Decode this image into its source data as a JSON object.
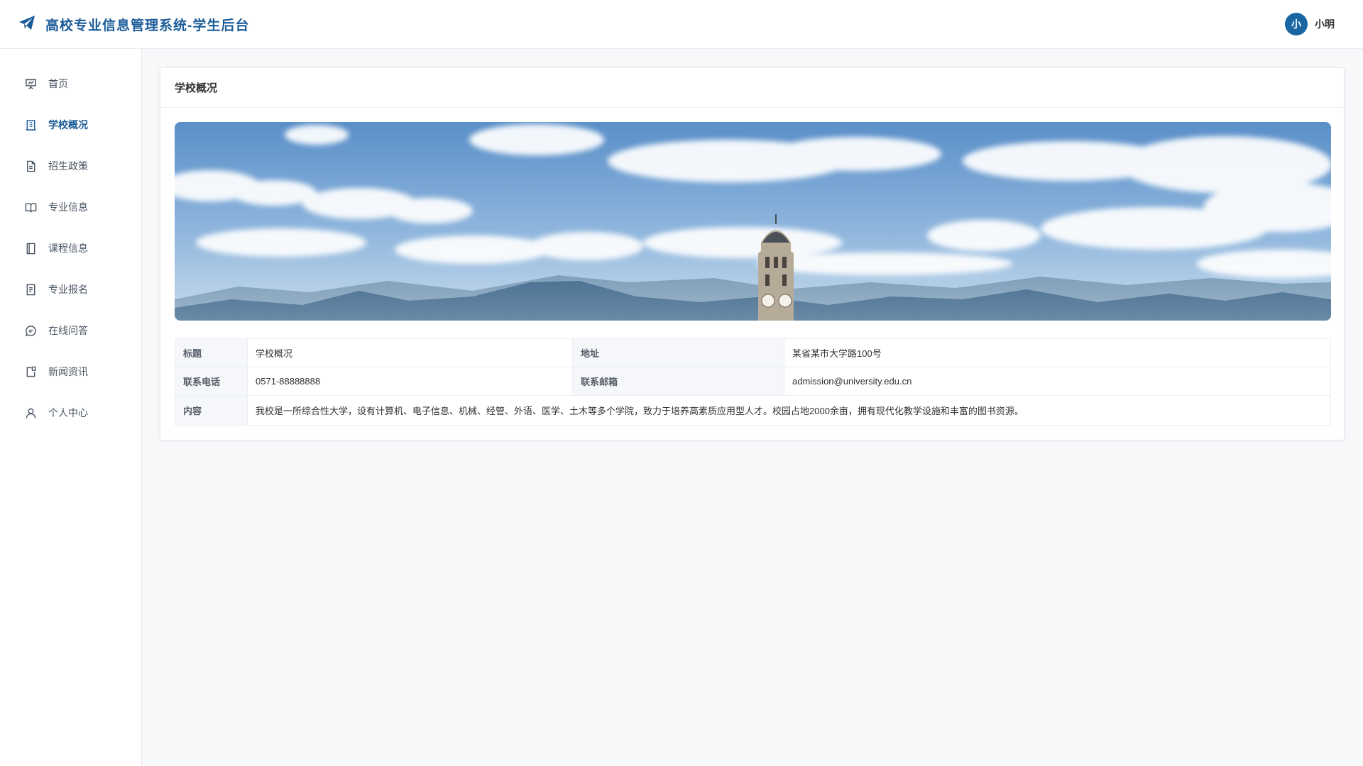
{
  "header": {
    "logo_icon": "paper-plane-icon",
    "title": "高校专业信息管理系统-学生后台",
    "user": {
      "avatar_letter": "小",
      "name": "小明"
    }
  },
  "sidebar": {
    "items": [
      {
        "label": "首页",
        "icon": "presentation-icon",
        "active": false
      },
      {
        "label": "学校概况",
        "icon": "building-icon",
        "active": true
      },
      {
        "label": "招生政策",
        "icon": "document-icon",
        "active": false
      },
      {
        "label": "专业信息",
        "icon": "book-open-icon",
        "active": false
      },
      {
        "label": "课程信息",
        "icon": "notebook-icon",
        "active": false
      },
      {
        "label": "专业报名",
        "icon": "form-icon",
        "active": false
      },
      {
        "label": "在线问答",
        "icon": "chat-bubble-icon",
        "active": false
      },
      {
        "label": "新闻资讯",
        "icon": "news-icon",
        "active": false
      },
      {
        "label": "个人中心",
        "icon": "user-icon",
        "active": false
      }
    ]
  },
  "main": {
    "card_title": "学校概况",
    "banner_alt": "校园风景",
    "info": {
      "title_label": "标题",
      "title_value": "学校概况",
      "address_label": "地址",
      "address_value": "某省某市大学路100号",
      "phone_label": "联系电话",
      "phone_value": "0571-88888888",
      "email_label": "联系邮箱",
      "email_value": "admission@university.edu.cn",
      "content_label": "内容",
      "content_value": "我校是一所综合性大学，设有计算机、电子信息、机械、经管、外语、医学、土木等多个学院，致力于培养高素质应用型人才。校园占地2000余亩，拥有现代化教学设施和丰富的图书资源。"
    }
  },
  "colors": {
    "accent": "#1b5c99",
    "avatar_bg": "#1a66a3"
  }
}
